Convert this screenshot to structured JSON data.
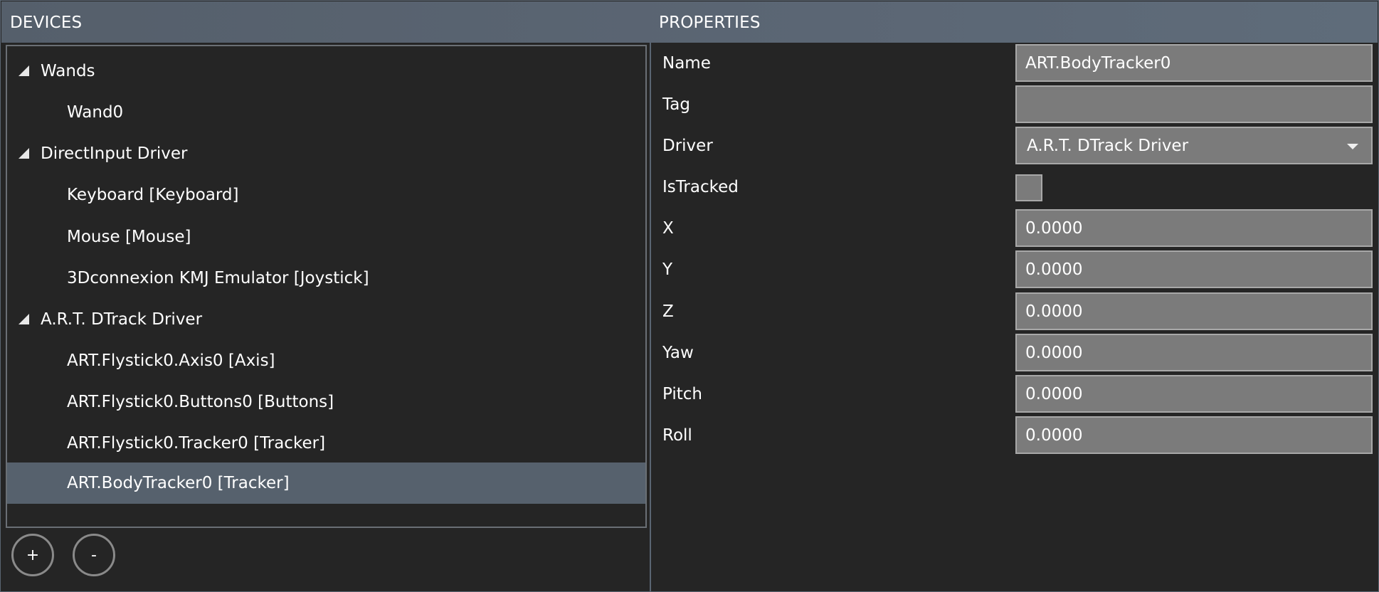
{
  "headers": {
    "devices": "DEVICES",
    "properties": "PROPERTIES"
  },
  "tree": [
    {
      "label": "Wands",
      "type": "group",
      "expanded": true
    },
    {
      "label": "Wand0",
      "type": "child"
    },
    {
      "label": "DirectInput Driver",
      "type": "group",
      "expanded": true
    },
    {
      "label": "Keyboard  [Keyboard]",
      "type": "child"
    },
    {
      "label": "Mouse  [Mouse]",
      "type": "child"
    },
    {
      "label": "3Dconnexion KMJ Emulator  [Joystick]",
      "type": "child"
    },
    {
      "label": "A.R.T. DTrack Driver",
      "type": "group",
      "expanded": true
    },
    {
      "label": "ART.Flystick0.Axis0  [Axis]",
      "type": "child"
    },
    {
      "label": "ART.Flystick0.Buttons0  [Buttons]",
      "type": "child"
    },
    {
      "label": "ART.Flystick0.Tracker0  [Tracker]",
      "type": "child"
    },
    {
      "label": "ART.BodyTracker0  [Tracker]",
      "type": "child",
      "selected": true
    }
  ],
  "buttons": {
    "add": "+",
    "remove": "-"
  },
  "properties": {
    "name": {
      "label": "Name",
      "value": "ART.BodyTracker0"
    },
    "tag": {
      "label": "Tag",
      "value": ""
    },
    "driver": {
      "label": "Driver",
      "value": "A.R.T. DTrack Driver"
    },
    "istracked": {
      "label": "IsTracked",
      "checked": false
    },
    "x": {
      "label": "X",
      "value": "0.0000"
    },
    "y": {
      "label": "Y",
      "value": "0.0000"
    },
    "z": {
      "label": "Z",
      "value": "0.0000"
    },
    "yaw": {
      "label": "Yaw",
      "value": "0.0000"
    },
    "pitch": {
      "label": "Pitch",
      "value": "0.0000"
    },
    "roll": {
      "label": "Roll",
      "value": "0.0000"
    }
  },
  "colors": {
    "header": "#5b6674",
    "background": "#252525",
    "selected_row": "#56616d",
    "field": "#7b7b7b"
  }
}
